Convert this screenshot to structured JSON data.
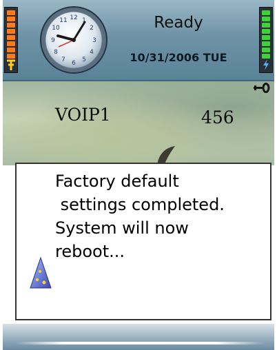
{
  "status": {
    "state_text": "Ready",
    "date_text": "10/31/2006 TUE",
    "signal_level_bars": 10,
    "battery_level_bars": 10
  },
  "clock": {
    "numerals": [
      "12",
      "1",
      "2",
      "3",
      "4",
      "5",
      "6",
      "7",
      "8",
      "9",
      "10",
      "11"
    ]
  },
  "idle_screen": {
    "line_name": "VOIP1",
    "extension": "456"
  },
  "popup": {
    "lines": [
      "Factory default",
      " settings completed.",
      "System will now",
      "reboot..."
    ],
    "icon": "wizard-hat-icon"
  },
  "colors": {
    "signal": "#ff7a1a",
    "battery": "#3ed13a",
    "header": "#6e93a6"
  }
}
